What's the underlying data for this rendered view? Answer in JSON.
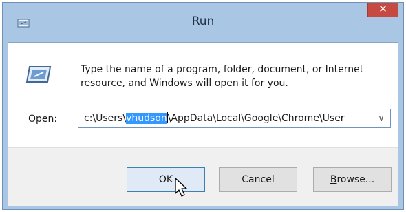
{
  "window": {
    "title": "Run",
    "close_glyph": "✕"
  },
  "message": {
    "text": "Type the name of a program, folder, document, or Internet resource, and Windows will open it for you."
  },
  "open_field": {
    "label_accel": "O",
    "label_rest": "pen:",
    "value_before": "c:\\Users\\",
    "value_selected": "vhudson",
    "value_after": "\\AppData\\Local\\Google\\Chrome\\User",
    "dropdown_glyph": "∨"
  },
  "buttons": {
    "ok_label": "OK",
    "cancel_label": "Cancel",
    "browse_accel": "B",
    "browse_rest": "rowse..."
  },
  "icons": {
    "title_icon": "run-dialog-icon",
    "big_icon": "run-program-icon",
    "cursor": "mouse-pointer-icon"
  },
  "colors": {
    "title_bar": "#a9c6e4",
    "close_button": "#c74a42",
    "selection": "#3399ff",
    "footer": "#f0f0f0"
  }
}
